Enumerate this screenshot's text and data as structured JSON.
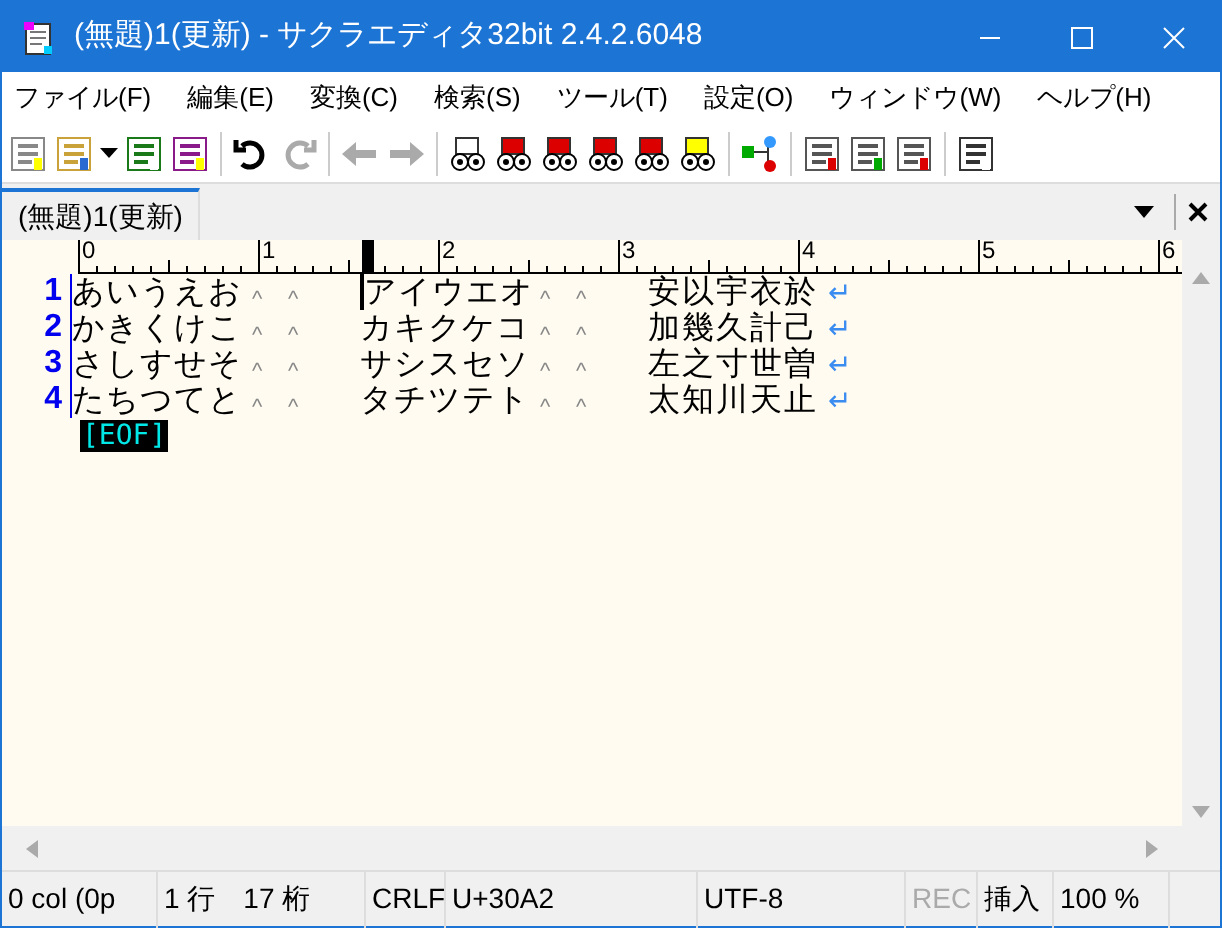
{
  "window": {
    "title": "(無題)1(更新) - サクラエディタ32bit 2.4.2.6048"
  },
  "menu": [
    "ファイル(F)",
    "編集(E)",
    "変換(C)",
    "検索(S)",
    "ツール(T)",
    "設定(O)",
    "ウィンドウ(W)",
    "ヘルプ(H)"
  ],
  "tabs": [
    {
      "label": "(無題)1(更新)",
      "selected": true
    }
  ],
  "ruler": [
    "0",
    "1",
    "2",
    "3",
    "4",
    "5",
    "6"
  ],
  "lines": [
    {
      "number": "1",
      "segments": [
        {
          "kind": "text",
          "text": "あいうえお",
          "cursor": false
        },
        {
          "kind": "tab",
          "text": "^"
        },
        {
          "kind": "tab",
          "text": "^"
        },
        {
          "kind": "text",
          "text": "アイウエオ",
          "cursor": true
        },
        {
          "kind": "tab",
          "text": "^"
        },
        {
          "kind": "tab",
          "text": "^"
        },
        {
          "kind": "text",
          "text": "安以宇衣於",
          "cursor": false
        },
        {
          "kind": "eol",
          "text": "↵"
        }
      ]
    },
    {
      "number": "2",
      "segments": [
        {
          "kind": "text",
          "text": "かきくけこ",
          "cursor": false
        },
        {
          "kind": "tab",
          "text": "^"
        },
        {
          "kind": "tab",
          "text": "^"
        },
        {
          "kind": "text",
          "text": "カキクケコ",
          "cursor": false
        },
        {
          "kind": "tab",
          "text": "^"
        },
        {
          "kind": "tab",
          "text": "^"
        },
        {
          "kind": "text",
          "text": "加幾久計己",
          "cursor": false
        },
        {
          "kind": "eol",
          "text": "↵"
        }
      ]
    },
    {
      "number": "3",
      "segments": [
        {
          "kind": "text",
          "text": "さしすせそ",
          "cursor": false
        },
        {
          "kind": "tab",
          "text": "^"
        },
        {
          "kind": "tab",
          "text": "^"
        },
        {
          "kind": "text",
          "text": "サシスセソ",
          "cursor": false
        },
        {
          "kind": "tab",
          "text": "^"
        },
        {
          "kind": "tab",
          "text": "^"
        },
        {
          "kind": "text",
          "text": "左之寸世曽",
          "cursor": false
        },
        {
          "kind": "eol",
          "text": "↵"
        }
      ]
    },
    {
      "number": "4",
      "segments": [
        {
          "kind": "text",
          "text": "たちつてと",
          "cursor": false
        },
        {
          "kind": "tab",
          "text": "^"
        },
        {
          "kind": "tab",
          "text": "^"
        },
        {
          "kind": "text",
          "text": "タチツテト",
          "cursor": false
        },
        {
          "kind": "tab",
          "text": "^"
        },
        {
          "kind": "tab",
          "text": "^"
        },
        {
          "kind": "text",
          "text": "太知川天止",
          "cursor": false
        },
        {
          "kind": "eol",
          "text": "↵"
        }
      ]
    }
  ],
  "eof": "[EOF]",
  "status_bar": [
    {
      "text": "0 col (0p",
      "disabled": false
    },
    {
      "text": "1 行　17 桁",
      "disabled": false
    },
    {
      "text": "CRLF",
      "disabled": false
    },
    {
      "text": "U+30A2",
      "disabled": false
    },
    {
      "text": "UTF-8",
      "disabled": false
    },
    {
      "text": "REC",
      "disabled": true
    },
    {
      "text": "挿入",
      "disabled": false
    },
    {
      "text": "100 %",
      "disabled": false
    }
  ]
}
